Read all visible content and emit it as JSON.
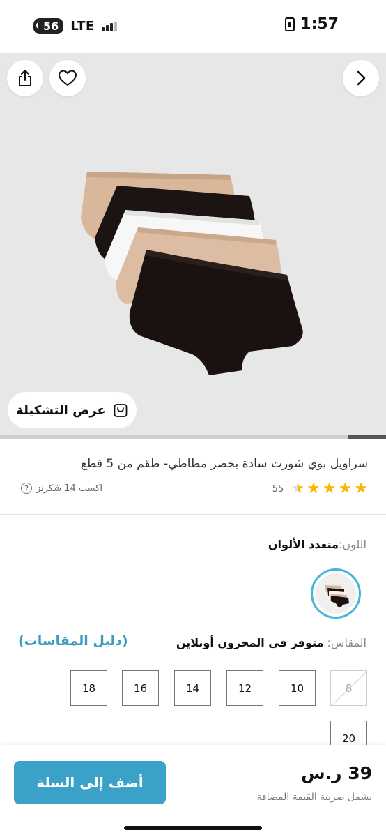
{
  "status_bar": {
    "signal_badge": "56",
    "network": "LTE",
    "time": "1:57"
  },
  "hero": {
    "share_icon": "share-icon",
    "wishlist_icon": "heart-icon",
    "next_icon": "chevron-right-icon",
    "view_collection_label": "عرض التشكيلة",
    "image_progress": 0.1
  },
  "product": {
    "title": "سراويل بوي شورت سادة بخصر مطاطي- طقم من 5 قطع",
    "rating": 4.5,
    "rating_count": "55",
    "earn_points": "اكسب 14 شكرنز",
    "help_icon_text": "?"
  },
  "color": {
    "label": "اللون:",
    "value": "متعدد الألوان"
  },
  "size": {
    "label": "المقاس:",
    "availability": "متوفر في المخزون أونلاين",
    "guide_link": "(دليل المقاسات)",
    "options": [
      {
        "label": "8",
        "available": false
      },
      {
        "label": "10",
        "available": true
      },
      {
        "label": "12",
        "available": true
      },
      {
        "label": "14",
        "available": true
      },
      {
        "label": "16",
        "available": true
      },
      {
        "label": "18",
        "available": true
      },
      {
        "label": "20",
        "available": true
      }
    ]
  },
  "bottom_bar": {
    "add_to_cart": "أضف إلى السلة",
    "price": "39 ر.س",
    "vat_note": "يشمل ضريبة القيمة المضافة"
  },
  "colors": {
    "accent": "#3aa1c9",
    "star": "#f5b800",
    "swatch_ring": "#3fb7d6",
    "hero_bg": "#e7e7e7"
  }
}
